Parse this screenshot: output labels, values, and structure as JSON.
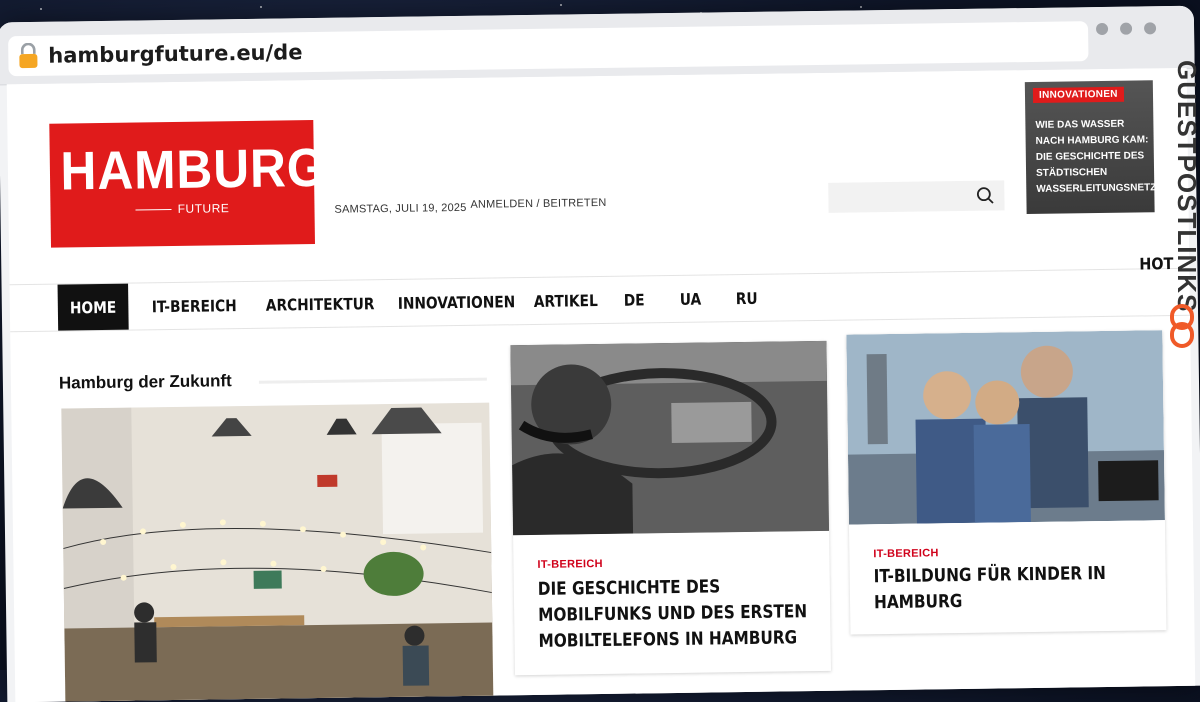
{
  "browser": {
    "url": "hamburgfuture.eu/de"
  },
  "site": {
    "logo_main": "HAMBURG",
    "logo_sub": "FUTURE",
    "date": "SAMSTAG, JULI 19, 2025",
    "login": "ANMELDEN / BEITRETEN",
    "search_placeholder": ""
  },
  "promo": {
    "tag": "INNOVATIONEN",
    "title": "WIE DAS WASSER NACH HAMBURG KAM: DIE GESCHICHTE DES STÄDTISCHEN WASSERLEITUNGSNETZES"
  },
  "nav": {
    "items": [
      "HOME",
      "IT-BEREICH",
      "ARCHITEKTUR",
      "INNOVATIONEN",
      "ARTIKEL",
      "DE",
      "UA",
      "RU"
    ],
    "hot": "HOT"
  },
  "watermark": {
    "text": "GUESTPOSTLINKS"
  },
  "section": {
    "title": "Hamburg der Zukunft"
  },
  "cards": [
    {
      "category": "IT-BEREICH",
      "title": "DIE GESCHICHTE DES MOBILFUNKS UND DES ERSTEN MOBILTELEFONS IN HAMBURG"
    },
    {
      "category": "IT-BEREICH",
      "title": "IT-BILDUNG FÜR KINDER IN HAMBURG"
    }
  ],
  "colors": {
    "brand_red": "#e01b1b",
    "category_red": "#d0021b",
    "nav_active_bg": "#111111"
  },
  "icons": [
    "lock-icon",
    "search-icon",
    "link-icon"
  ]
}
